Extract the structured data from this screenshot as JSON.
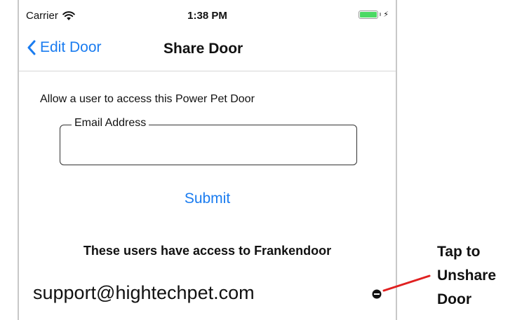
{
  "status_bar": {
    "carrier": "Carrier",
    "wifi_icon": "wifi-icon",
    "time": "1:38 PM",
    "battery_icon": "battery-charging-icon",
    "battery_level": 1.0,
    "battery_color": "#4cd964"
  },
  "nav": {
    "back_label": "Edit Door",
    "back_icon": "chevron-left-icon",
    "title": "Share Door",
    "accent_color": "#1a7cf0"
  },
  "share_form": {
    "intro": "Allow a user to access this Power Pet Door",
    "email_label": "Email Address",
    "email_value": "",
    "submit_label": "Submit"
  },
  "shared_users": {
    "heading": "These users have access to Frankendoor",
    "items": [
      {
        "email": "support@hightechpet.com",
        "remove_icon": "minus-circle-icon"
      }
    ]
  },
  "annotation": {
    "lines": [
      "Tap to",
      "Unshare",
      "Door"
    ],
    "pointer_color": "#e02020"
  }
}
